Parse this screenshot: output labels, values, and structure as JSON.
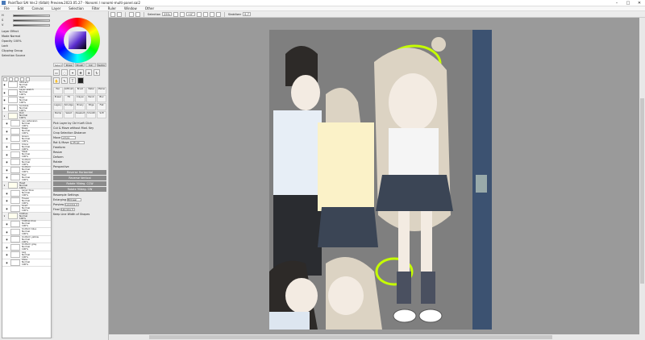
{
  "window": {
    "title": "PaintTool SAI Ver.2 (64bit) Preview.2023.05.27 - Nonomi / nonomi-multi-panel.sai2",
    "controls": [
      "–",
      "□",
      "✕"
    ]
  },
  "menu": [
    "File",
    "Edit",
    "Canvas",
    "Layer",
    "Selection",
    "Filter",
    "Ruler",
    "Window",
    "Other"
  ],
  "toolbar": {
    "selection_label": "Selection",
    "zoom": "25%",
    "angle": "+0°",
    "stabilizer_label": "Stabilizer",
    "stabilizer_value": "S-7"
  },
  "color_sliders": [
    {
      "label": "H"
    },
    {
      "label": "S"
    },
    {
      "label": "V"
    }
  ],
  "layer_props": {
    "effect_label": "Layer Effect",
    "mode_label": "Mode",
    "mode_value": "Normal",
    "opacity_label": "Opacity",
    "opacity_value": "100%",
    "lock_label": "Lock",
    "clipping": "Clipping Group",
    "selection_source": "Selection Source"
  },
  "tool_tabs": [
    "Select",
    "Draw",
    "Brush",
    "Ink",
    "Vector"
  ],
  "brushes": [
    "Pen",
    "AirBrush",
    "Brush",
    "Water",
    "Marker",
    "Eraser",
    "Fill",
    "Crayon",
    "Pencil",
    "Blur",
    "Legacy",
    "Smudge",
    "Binary",
    "Edge",
    "Flat",
    "Stamp",
    "Select",
    "Deselect",
    "Smooth",
    "Soft"
  ],
  "transform_opts": {
    "pick_layer": "Pick Layer by Ctrl+Left Click",
    "cut_move": "Cut & Move without Mod. Key",
    "crop_label": "Crop Selection Distance",
    "move_label": "Move",
    "move_value": "+0 px",
    "rot_label": "Rot & Move",
    "rot_value": "+15 px",
    "freeform": "Freeform",
    "resize": "Resize",
    "deform": "Deform",
    "rotate": "Rotate",
    "perspective_label": "Perspective",
    "btn_reverse_h": "Reverse Horizontal",
    "btn_reverse_v": "Reverse Vertical",
    "btn_rotate_cw": "Rotate 90deg. CCW",
    "btn_rotate_ccw": "Rotate 90deg. CW",
    "resample_label": "Resample Settings",
    "enlarge_label": "Enlarging",
    "enlarge_value": "Bilinear",
    "preview_label": "Preview",
    "preview_value": "Lanczos 2",
    "final_label": "Final",
    "final_value": "Lanczos 3",
    "keep_width": "Keep Line Width of Shapes"
  },
  "layers": [
    {
      "name": "Stickers",
      "mode": "Normal",
      "opacity": "100%",
      "folder": false,
      "indent": false
    },
    {
      "name": "Layer sketch",
      "mode": "Normal",
      "opacity": "100%",
      "folder": false,
      "indent": false
    },
    {
      "name": "Halo",
      "mode": "Normal",
      "opacity": "100%",
      "folder": false,
      "indent": false
    },
    {
      "name": "Scribble",
      "mode": "Normal",
      "opacity": "100%",
      "folder": false,
      "indent": false
    },
    {
      "name": "Doll",
      "mode": "Normal",
      "opacity": "100%",
      "folder": true,
      "indent": false
    },
    {
      "name": "Lay extension",
      "mode": "Normal",
      "opacity": "100%",
      "folder": false,
      "indent": true
    },
    {
      "name": "Deep",
      "mode": "Normal",
      "opacity": "100%",
      "folder": false,
      "indent": true
    },
    {
      "name": "Green",
      "mode": "Normal",
      "opacity": "100%",
      "folder": false,
      "indent": true
    },
    {
      "name": "Clone",
      "mode": "Normal",
      "opacity": "100%",
      "folder": false,
      "indent": true
    },
    {
      "name": "Steel",
      "mode": "Normal",
      "opacity": "100%",
      "folder": false,
      "indent": true
    },
    {
      "name": "Uniform",
      "mode": "Normal",
      "opacity": "100%",
      "folder": false,
      "indent": true
    },
    {
      "name": "Uniform",
      "mode": "Normal",
      "opacity": "100%",
      "folder": false,
      "indent": true
    },
    {
      "name": "Hair",
      "mode": "Normal",
      "opacity": "100%",
      "folder": false,
      "indent": true
    },
    {
      "name": "Head",
      "mode": "Normal",
      "opacity": "100%",
      "folder": true,
      "indent": false
    },
    {
      "name": "Layer blue",
      "mode": "Normal",
      "opacity": "100%",
      "folder": false,
      "indent": true
    },
    {
      "name": "Flower",
      "mode": "Normal",
      "opacity": "100%",
      "folder": false,
      "indent": true
    },
    {
      "name": "Scarf",
      "mode": "Normal",
      "opacity": "100%",
      "folder": false,
      "indent": true
    },
    {
      "name": "Clothes",
      "mode": "Normal",
      "opacity": "100%",
      "folder": true,
      "indent": false
    },
    {
      "name": "Clothes blue",
      "mode": "Normal",
      "opacity": "100%",
      "folder": false,
      "indent": true
    },
    {
      "name": "Uniform blue",
      "mode": "Normal",
      "opacity": "100%",
      "folder": false,
      "indent": true
    },
    {
      "name": "Uniform yellow",
      "mode": "Normal",
      "opacity": "100%",
      "folder": false,
      "indent": true
    },
    {
      "name": "Uniform gray",
      "mode": "Normal",
      "opacity": "100%",
      "folder": false,
      "indent": true
    },
    {
      "name": "Leg",
      "mode": "Normal",
      "opacity": "100%",
      "folder": false,
      "indent": true
    },
    {
      "name": "Shoe",
      "mode": "Normal",
      "opacity": "100%",
      "folder": false,
      "indent": true
    }
  ],
  "colors": {
    "canvas_bg": "#9a9a9a",
    "art_bg": "#7f7f7f",
    "halo": "#c6ff00",
    "door": "#3c5271"
  }
}
